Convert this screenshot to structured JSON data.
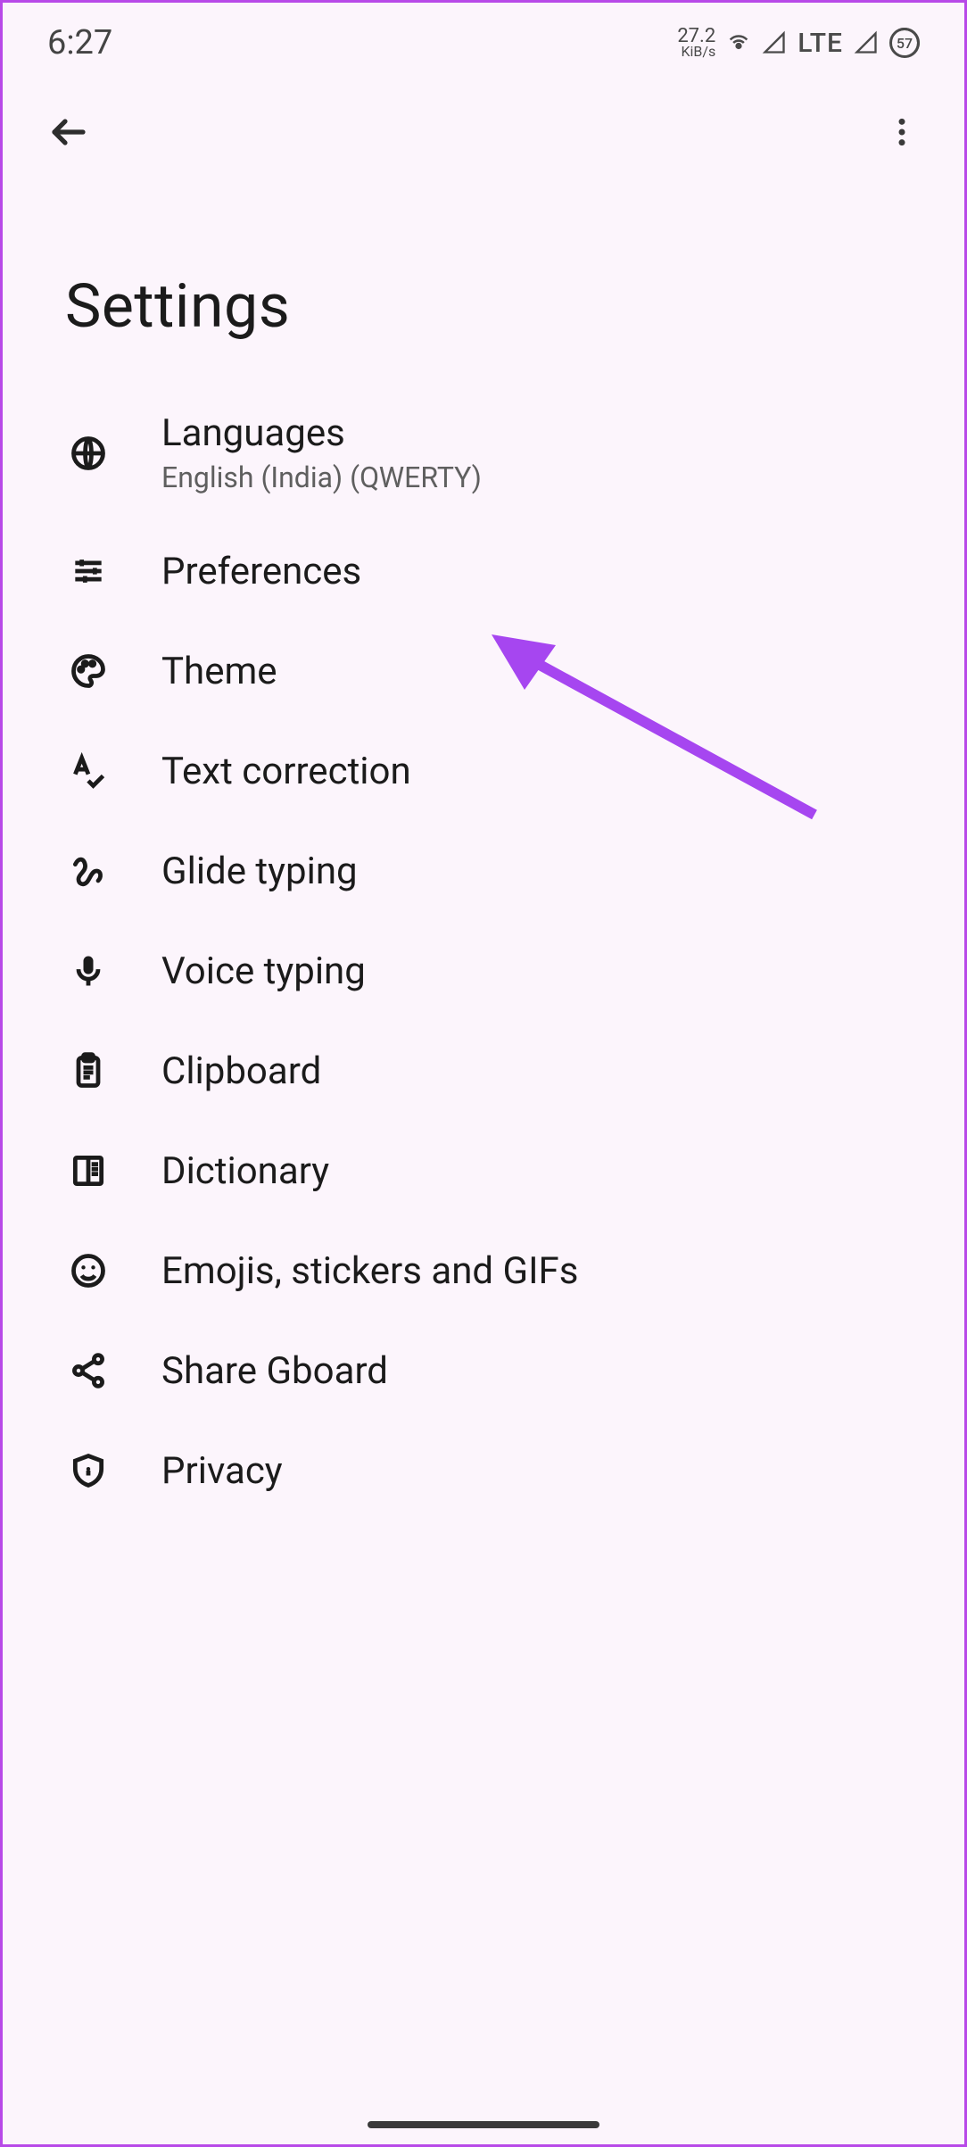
{
  "statusBar": {
    "time": "6:27",
    "netSpeedValue": "27.2",
    "netSpeedUnits": "KiB/s",
    "networkType": "LTE",
    "batteryLevel": "57"
  },
  "header": {
    "title": "Settings"
  },
  "settingsList": [
    {
      "key": "languages",
      "title": "Languages",
      "subtitle": "English (India) (QWERTY)",
      "icon": "globe-icon"
    },
    {
      "key": "preferences",
      "title": "Preferences",
      "icon": "sliders-icon"
    },
    {
      "key": "theme",
      "title": "Theme",
      "icon": "palette-icon"
    },
    {
      "key": "text-correction",
      "title": "Text correction",
      "icon": "spellcheck-icon"
    },
    {
      "key": "glide-typing",
      "title": "Glide typing",
      "icon": "gesture-icon"
    },
    {
      "key": "voice-typing",
      "title": "Voice typing",
      "icon": "mic-icon"
    },
    {
      "key": "clipboard",
      "title": "Clipboard",
      "icon": "clipboard-icon"
    },
    {
      "key": "dictionary",
      "title": "Dictionary",
      "icon": "book-icon"
    },
    {
      "key": "emojis",
      "title": "Emojis, stickers and GIFs",
      "icon": "smiley-icon"
    },
    {
      "key": "share-gboard",
      "title": "Share Gboard",
      "icon": "share-icon"
    },
    {
      "key": "privacy",
      "title": "Privacy",
      "icon": "shield-icon"
    }
  ],
  "annotation": {
    "arrowColor": "#a646f0"
  }
}
